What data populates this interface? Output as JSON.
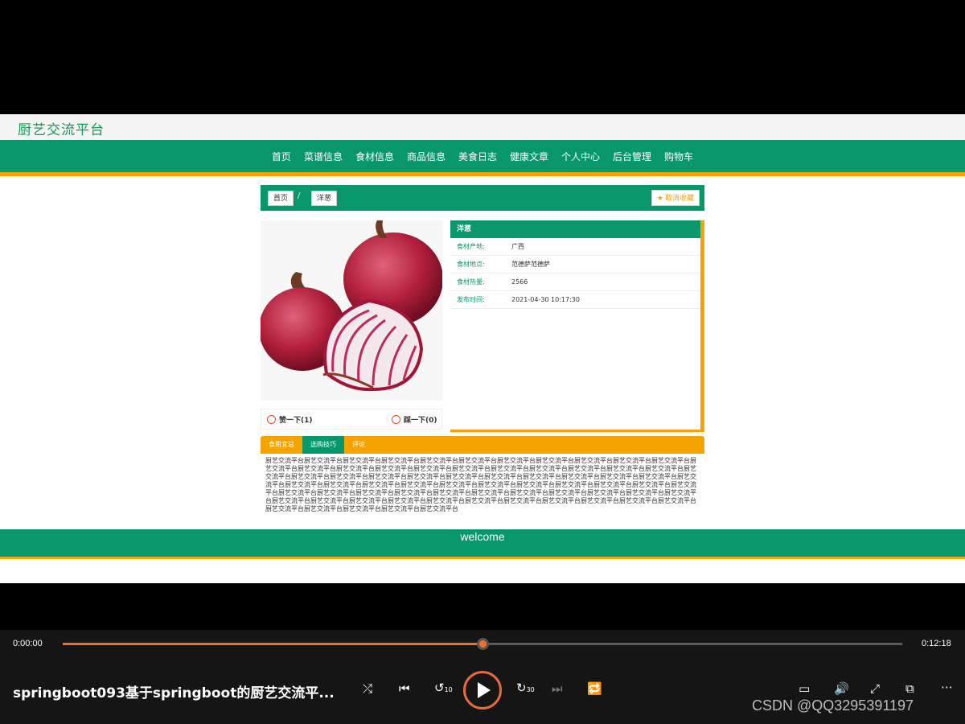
{
  "site": {
    "logo": "厨艺交流平台",
    "nav": [
      "首页",
      "菜谱信息",
      "食材信息",
      "商品信息",
      "美食日志",
      "健康文章",
      "个人中心",
      "后台管理",
      "购物车"
    ]
  },
  "breadcrumb": {
    "home": "首页",
    "current": "洋葱",
    "favorite": "取消收藏"
  },
  "ingredient": {
    "name": "洋葱",
    "fields": [
      {
        "label": "食材产地:",
        "value": "广西"
      },
      {
        "label": "食材地点:",
        "value": "范德萨范德萨"
      },
      {
        "label": "食材热量:",
        "value": "2566"
      },
      {
        "label": "发布时间:",
        "value": "2021-04-30 10:17:30"
      }
    ],
    "like_label": "赞一下(1)",
    "dislike_label": "踩一下(0)"
  },
  "tabs": {
    "items": [
      "食用宜忌",
      "选购技巧",
      "评论"
    ],
    "active": 1,
    "text": "厨艺交流平台厨艺交流平台厨艺交流平台厨艺交流平台厨艺交流平台厨艺交流平台厨艺交流平台厨艺交流平台厨艺交流平台厨艺交流平台厨艺交流平台厨艺交流平台厨艺交流平台厨艺交流平台厨艺交流平台厨艺交流平台厨艺交流平台厨艺交流平台厨艺交流平台厨艺交流平台厨艺交流平台厨艺交流平台厨艺交流平台厨艺交流平台厨艺交流平台厨艺交流平台厨艺交流平台厨艺交流平台厨艺交流平台厨艺交流平台厨艺交流平台厨艺交流平台厨艺交流平台厨艺交流平台厨艺交流平台厨艺交流平台厨艺交流平台厨艺交流平台厨艺交流平台厨艺交流平台厨艺交流平台厨艺交流平台厨艺交流平台厨艺交流平台厨艺交流平台厨艺交流平台厨艺交流平台厨艺交流平台厨艺交流平台厨艺交流平台厨艺交流平台厨艺交流平台厨艺交流平台厨艺交流平台厨艺交流平台厨艺交流平台厨艺交流平台厨艺交流平台厨艺交流平台厨艺交流平台厨艺交流平台厨艺交流平台厨艺交流平台厨艺交流平台厨艺交流平台厨艺交流平台厨艺交流平台厨艺交流平台厨艺交流平台厨艺交流平台厨艺交流平台厨艺交流平台"
  },
  "footer": {
    "text": "welcome"
  },
  "player": {
    "current_time": "0:00:00",
    "total_time": "0:12:18",
    "progress": 0.5,
    "title": "springboot093基于springboot的厨艺交流平...",
    "watermark": "CSDN @QQ3295391197",
    "colors": {
      "accent": "#f0702d",
      "site_green": "#07976a",
      "site_orange": "#f5a300"
    }
  }
}
